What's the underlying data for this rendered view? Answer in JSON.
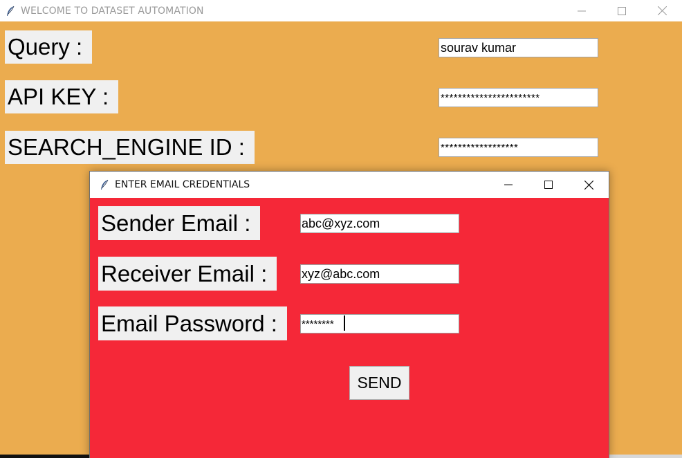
{
  "main_window": {
    "title": "WELCOME TO DATASET AUTOMATION",
    "background_color": "#ebac4f",
    "icon": "feather-icon",
    "controls": [
      "minimize-icon",
      "maximize-icon",
      "close-icon"
    ],
    "fields": {
      "query": {
        "label": "Query :",
        "value": "sourav kumar"
      },
      "api_key": {
        "label": "API KEY :",
        "value": "***********************"
      },
      "search_engine_id": {
        "label": "SEARCH_ENGINE ID :",
        "value": "******************"
      }
    }
  },
  "dialog": {
    "title": "ENTER EMAIL CREDENTIALS",
    "background_color": "#f52838",
    "icon": "feather-icon",
    "controls": [
      "minimize-icon",
      "maximize-icon",
      "close-icon"
    ],
    "fields": {
      "sender_email": {
        "label": "Sender Email :",
        "value": "abc@xyz.com"
      },
      "receiver_email": {
        "label": "Receiver Email :",
        "value": "xyz@abc.com"
      },
      "email_password": {
        "label": "Email Password :",
        "value": "********"
      }
    },
    "send_button": "SEND"
  }
}
